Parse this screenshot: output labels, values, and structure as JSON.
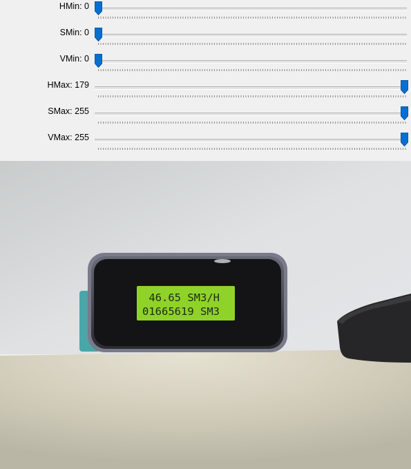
{
  "window": {
    "title": ""
  },
  "trackbars": [
    {
      "label": "HMin: 0",
      "value": 0,
      "max": 179
    },
    {
      "label": "SMin: 0",
      "value": 0,
      "max": 255
    },
    {
      "label": "VMin: 0",
      "value": 0,
      "max": 255
    },
    {
      "label": "HMax: 179",
      "value": 179,
      "max": 179
    },
    {
      "label": "SMax: 255",
      "value": 255,
      "max": 255
    },
    {
      "label": "VMax: 255",
      "value": 255,
      "max": 255
    }
  ],
  "camera": {
    "lcd_line1": " 46.65 SM3/H",
    "lcd_line2": "01665619 SM3"
  },
  "colors": {
    "thumb": "#0a6ed1",
    "lcd": "#8fd22a",
    "wall": "#dcdedf",
    "desk": "#cbc8b8"
  }
}
